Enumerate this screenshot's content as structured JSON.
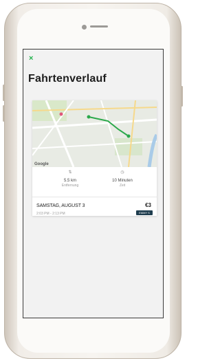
{
  "screen": {
    "close_icon": "×",
    "title": "Fahrtenverlauf"
  },
  "trip_card": {
    "map": {
      "watermark": "Google"
    },
    "distance": {
      "value": "5.5 km",
      "label": "Entfernung"
    },
    "duration": {
      "value": "10 Minuten",
      "label": "Zeit"
    },
    "date": "SAMSTAG, AUGUST 3",
    "time_range": "2:03 PM - 2:13 PM",
    "price": "€3",
    "badge": "EMMY S"
  },
  "colors": {
    "accent": "#22b14c",
    "badge": "#1f3d4e",
    "route": "#2aa84a"
  }
}
